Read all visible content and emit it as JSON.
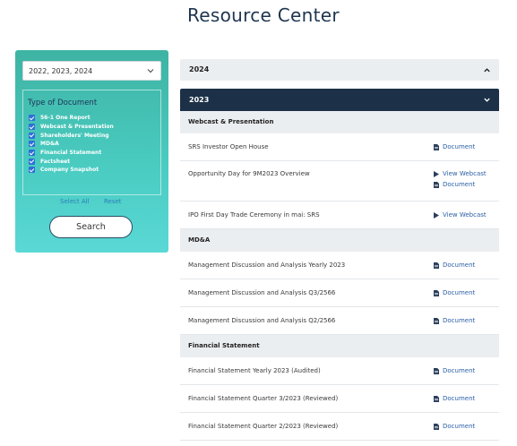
{
  "page": {
    "title": "Resource Center"
  },
  "filter": {
    "year_value": "2022, 2023, 2024",
    "type_heading": "Type of Document",
    "types": [
      "56-1 One Report",
      "Webcast & Presentation",
      "Shareholders' Meeting",
      "MD&A",
      "Financial Statement",
      "Factsheet",
      "Company Snapshot"
    ],
    "select_all": "Select All",
    "reset": "Reset",
    "search": "Search"
  },
  "accordion": {
    "y2024": "2024",
    "y2023": "2023"
  },
  "sections": [
    {
      "name": "Webcast & Presentation",
      "rows": [
        {
          "title": "SRS Investor Open House",
          "links": [
            {
              "kind": "doc",
              "label": "Document"
            }
          ]
        },
        {
          "title": "Opportunity Day for 9M2023 Overview",
          "links": [
            {
              "kind": "play",
              "label": "View Webcast"
            },
            {
              "kind": "doc",
              "label": "Document"
            }
          ]
        },
        {
          "title": "IPO First Day Trade Ceremony in mai: SRS",
          "links": [
            {
              "kind": "play",
              "label": "View Webcast"
            }
          ]
        }
      ]
    },
    {
      "name": "MD&A",
      "rows": [
        {
          "title": "Management Discussion and Analysis Yearly 2023",
          "links": [
            {
              "kind": "doc",
              "label": "Document"
            }
          ]
        },
        {
          "title": "Management Discussion and Analysis Q3/2566",
          "links": [
            {
              "kind": "doc",
              "label": "Document"
            }
          ]
        },
        {
          "title": "Management Discussion and Analysis Q2/2566",
          "links": [
            {
              "kind": "doc",
              "label": "Document"
            }
          ]
        }
      ]
    },
    {
      "name": "Financial Statement",
      "rows": [
        {
          "title": "Financial Statement Yearly 2023 (Audited)",
          "links": [
            {
              "kind": "doc",
              "label": "Document"
            }
          ]
        },
        {
          "title": "Financial Statement Quarter 3/2023 (Reviewed)",
          "links": [
            {
              "kind": "doc",
              "label": "Document"
            }
          ]
        },
        {
          "title": "Financial Statement Quarter 2/2023 (Reviewed)",
          "links": [
            {
              "kind": "doc",
              "label": "Document"
            }
          ]
        }
      ]
    }
  ]
}
